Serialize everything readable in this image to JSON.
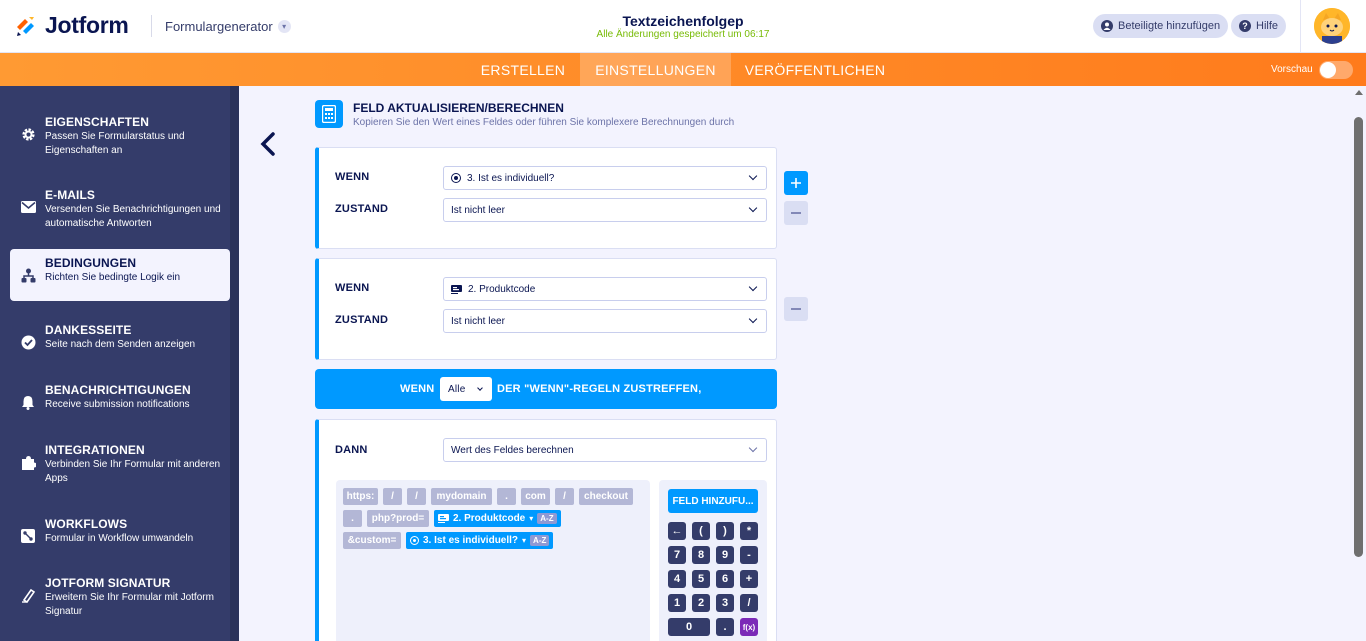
{
  "header": {
    "logo_text": "Jotform",
    "builder_label": "Formulargenerator",
    "form_title": "Textzeichenfolgep",
    "saved_status": "Alle Änderungen gespeichert um 06:17",
    "add_participants_label": "Beteiligte hinzufügen",
    "help_label": "Hilfe"
  },
  "nav": {
    "tabs": [
      {
        "label": "ERSTELLEN"
      },
      {
        "label": "EINSTELLUNGEN"
      },
      {
        "label": "VERÖFFENTLICHEN"
      }
    ],
    "active_tab": "EINSTELLUNGEN",
    "preview_label": "Vorschau"
  },
  "sidebar": {
    "items": [
      {
        "title": "EIGENSCHAFTEN",
        "desc": "Passen Sie Formularstatus und Eigenschaften an",
        "icon": "gear-icon"
      },
      {
        "title": "E-MAILS",
        "desc": "Versenden Sie Benachrichtigungen und automatische Antworten",
        "icon": "envelope-icon"
      },
      {
        "title": "BEDINGUNGEN",
        "desc": "Richten Sie bedingte Logik ein",
        "icon": "sitemap-icon"
      },
      {
        "title": "DANKESSEITE",
        "desc": "Seite nach dem Senden anzeigen",
        "icon": "check-circle-icon"
      },
      {
        "title": "BENACHRICHTIGUNGEN",
        "desc": "Receive submission notifications",
        "icon": "bell-icon"
      },
      {
        "title": "INTEGRATIONEN",
        "desc": "Verbinden Sie Ihr Formular mit anderen Apps",
        "icon": "puzzle-icon"
      },
      {
        "title": "WORKFLOWS",
        "desc": "Formular in Workflow umwandeln",
        "icon": "workflow-icon"
      },
      {
        "title": "JOTFORM SIGNATUR",
        "desc": "Erweitern Sie Ihr Formular mit Jotform Signatur",
        "icon": "pen-icon"
      }
    ],
    "active_item": "BEDINGUNGEN"
  },
  "condition": {
    "title": "FELD AKTUALISIEREN/BERECHNEN",
    "subtitle": "Kopieren Sie den Wert eines Feldes oder führen Sie komplexere Berechnungen durch",
    "rules": [
      {
        "if_label": "WENN",
        "field": "3. Ist es individuell?",
        "field_icon": "radio-icon",
        "state_label": "ZUSTAND",
        "state": "Ist nicht leer"
      },
      {
        "if_label": "WENN",
        "field": "2. Produktcode",
        "field_icon": "code-icon",
        "state_label": "ZUSTAND",
        "state": "Ist nicht leer"
      }
    ],
    "match_bar": {
      "prefix": "WENN",
      "selector": "Alle",
      "suffix": "DER \"WENN\"-REGELN ZUSTREFFEN,"
    },
    "action": {
      "then_label": "DANN",
      "action_value": "Wert des Feldes berechnen",
      "tokens_row1": [
        "https:",
        "/",
        "/",
        "mydomain",
        ".",
        "com",
        "/",
        "checkout"
      ],
      "tokens_row2_text": [
        ".",
        "php?prod="
      ],
      "field_token_1": "2. Produktcode",
      "token_row3_text": "&custom=",
      "field_token_2": "3. Ist es individuell?",
      "az_label": "A-Z",
      "add_field_label": "FELD HINZUFU...",
      "keypad": [
        "←",
        "(",
        ")",
        "*",
        "7",
        "8",
        "9",
        "-",
        "4",
        "5",
        "6",
        "+",
        "1",
        "2",
        "3",
        "/",
        "0",
        ".",
        "f(x)"
      ]
    }
  },
  "colors": {
    "accent_blue": "#0099ff",
    "nav_orange": "#ff7b1c",
    "sidebar_bg": "#343c6a",
    "saved_green": "#78bb07"
  }
}
